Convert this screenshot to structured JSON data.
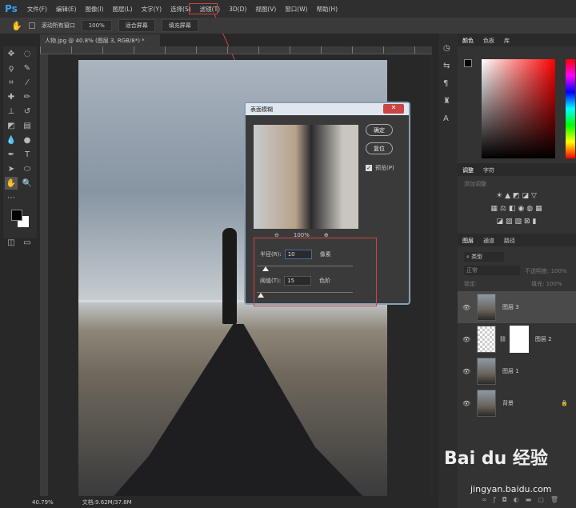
{
  "app": {
    "logo": "Ps"
  },
  "menu": [
    "文件(F)",
    "编辑(E)",
    "图像(I)",
    "图层(L)",
    "文字(Y)",
    "选择(S)",
    "滤镜(T)",
    "3D(D)",
    "视图(V)",
    "窗口(W)",
    "帮助(H)"
  ],
  "options": {
    "scroll_all": "滚动所有窗口",
    "zoom100": "100%",
    "fit_screen": "适合屏幕",
    "fill_screen": "填充屏幕"
  },
  "document_tab": "人物.jpg @ 40.8% (图层 3, RGB/8*) *",
  "status": {
    "zoom": "40.79%",
    "doc": "文档:9.62M/37.8M"
  },
  "dialog": {
    "title": "表面模糊",
    "ok": "确定",
    "reset": "复位",
    "preview_label": "预览(P)",
    "preview_checked": true,
    "zoom": "100%",
    "radius_label": "半径(R):",
    "radius_value": "10",
    "radius_unit": "像素",
    "threshold_label": "阈值(T):",
    "threshold_value": "15",
    "threshold_unit": "色阶"
  },
  "panels": {
    "color_tabs": [
      "颜色",
      "色板",
      "库"
    ],
    "adjust_tabs": [
      "调整",
      "字符"
    ],
    "adjust_hint": "添加调整",
    "layer_tabs": [
      "图层",
      "通道",
      "路径"
    ],
    "filter_kind": "类型",
    "blend": "正常",
    "opacity_label": "不透明度:",
    "opacity": "100%",
    "lock_label": "锁定:",
    "fill_label": "填充:",
    "fill": "100%"
  },
  "layers": [
    {
      "name": "图层 3",
      "selected": true
    },
    {
      "name": "图层 2",
      "mask": true
    },
    {
      "name": "图层 1"
    },
    {
      "name": "背景",
      "locked": true
    }
  ],
  "watermark": {
    "brand": "Bai du 经验",
    "url": "jingyan.baidu.com"
  }
}
